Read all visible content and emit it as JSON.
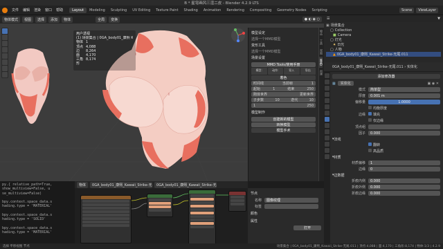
{
  "window_title": "B * 星穹画风三渲二皮 - Blender 4.2.9 LTS",
  "menu": [
    "文件",
    "编辑",
    "渲染",
    "窗口",
    "帮助"
  ],
  "workspaces": [
    "Layout",
    "Modeling",
    "Sculpting",
    "UV Editing",
    "Texture Paint",
    "Shading",
    "Animation",
    "Rendering",
    "Compositing",
    "Geometry Nodes",
    "Scripting"
  ],
  "active_workspace": "Layout",
  "top_right": {
    "scene": "Scene",
    "view_layer": "ViewLayer"
  },
  "viewport_header": {
    "mode": "物体模式",
    "view": "视图",
    "select": "选择",
    "add": "添加",
    "object": "物体",
    "orientation": "全局",
    "transform": "变换"
  },
  "stats": {
    "view_name": "用户透视",
    "collection": "(1) 场景集合 | 0GA_body01_康熙 Kawaii_Strike-无尾.011",
    "rows": [
      {
        "k": "物体",
        "v": "1"
      },
      {
        "k": "顶点",
        "v": "4,088"
      },
      {
        "k": "边",
        "v": "8,264"
      },
      {
        "k": "面",
        "v": "4,170"
      },
      {
        "k": "三角形",
        "v": "8,174"
      }
    ]
  },
  "mmd_panel": {
    "model_setup": "模型设定",
    "select_model": "选择一个MMD模型",
    "deform_tools": "变形工具",
    "select_model2": "选择一个MMD模型",
    "scene_settings": "场景设置",
    "tools_title": "MMD Tools/使用手册",
    "model": "模型:",
    "action": "动作:",
    "import": "导入",
    "export": "导出",
    "shading": "着色",
    "timeline": "时间线",
    "current_frame": "当前帧",
    "current_frame_val": "1",
    "start_label": "起始",
    "start_val": "1",
    "end_label": "结束",
    "end_val": "250",
    "physics": "刚体世界",
    "update_world": "更新世界",
    "substeps_label": "子步数",
    "substeps_val": "10",
    "iterations_label": "迭代",
    "iterations_val": "10",
    "start2_val": "1",
    "end2_val": "250",
    "model_make": "模型制作",
    "create_model": "创建新的模型",
    "convert_model": "转换模型",
    "adjust_hand": "模型手术"
  },
  "side_tabs": [
    "物品",
    "工具",
    "视图",
    "MMD",
    "创建"
  ],
  "outliner": {
    "title": "场景集合",
    "rows": [
      {
        "label": "Collection",
        "sel": false
      },
      {
        "label": "Camera",
        "sel": false
      },
      {
        "label": "灯光",
        "sel": false
      },
      {
        "label": "日光",
        "sel": false
      },
      {
        "label": "人物",
        "sel": false
      },
      {
        "label": "0GA_body01_康熙_Kawaii_Strike-无尾.011",
        "sel": true
      }
    ]
  },
  "properties": {
    "breadcrumb": "0GA_body01_康熙_Kawaii_Strike-无尾.011 › 实体化",
    "add_modifier": "添加修改器",
    "modifier_name": "实体化",
    "rows": [
      {
        "k": "模式",
        "v": "简单型"
      },
      {
        "k": "厚度",
        "v": "0.001 m"
      },
      {
        "k": "偏移量",
        "v": "1.0000",
        "blue": true
      },
      {
        "k": "",
        "v": "均衡厚度"
      },
      {
        "k": "边缘",
        "v": "填充"
      },
      {
        "k": "",
        "v": "仅边缘"
      },
      {
        "k": "顶点组",
        "v": ""
      },
      {
        "k": "因子",
        "v": "0.000"
      }
    ],
    "normals": "法线",
    "flip": "翻转",
    "high_quality": "高品质",
    "material": "材质",
    "material_offset_label": "材质偏移",
    "material_offset_val": "1",
    "rim_label": "边缘",
    "rim_val": "0",
    "edge_data": "边数据",
    "crease_inner_label": "折痕内侧",
    "crease_inner_val": "0.000",
    "crease_outer_label": "折痕外侧",
    "crease_outer_val": "0.000",
    "crease_edge_label": "折痕边缘",
    "crease_edge_val": "0.000"
  },
  "console_lines": [
    "py.{ relative_path=True,",
    " show_multiview=False, u",
    "se_multiview=False)",
    "",
    "bpy.context.space_data.s",
    "hading.type = 'MATERIAL'",
    "",
    "bpy.context.space_data.s",
    "hading.type = 'SOLID'",
    "",
    "bpy.context.space_data.s",
    "hading.type = 'MATERIAL'"
  ],
  "node_editor": {
    "object": "物体",
    "material": "0GA_body01_康熙_Kawaii_Strike-无尾.011",
    "slot": "0GA_body01_康熙_Kawaii_Strike-无尾.011"
  },
  "node_side": {
    "node": "节点",
    "name_label": "名称",
    "name_val": "图像纹理",
    "label_label": "标签",
    "color": "颜色",
    "properties": "属性",
    "open": "打开"
  },
  "status_left": "选择  平移视图  节点",
  "status_right": "场景集合 | 0GA_body01_康熙_Kawaii_Strike-无尾.011 | 顶点:4,088 | 面:4,170 | 三角形:8,174 | 物体:1/3 | 4.2.9"
}
